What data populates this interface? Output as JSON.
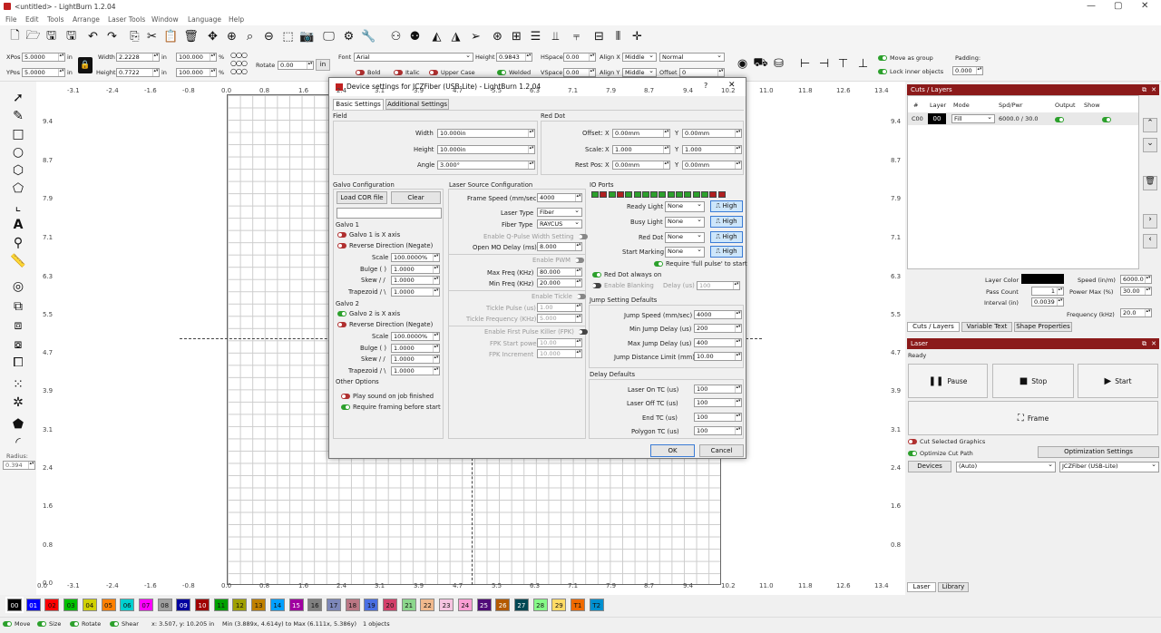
{
  "titlebar": {
    "title": "<untitled> - LightBurn 1.2.04"
  },
  "menu": [
    "File",
    "Edit",
    "Tools",
    "Arrange",
    "Laser Tools",
    "Window",
    "Language",
    "Help"
  ],
  "toolbar2": {
    "xpos_label": "XPos",
    "xpos": "5.0000",
    "ypos_label": "YPos",
    "ypos": "5.0000",
    "unit": "in",
    "width_label": "Width",
    "width": "2.2228",
    "height_label": "Height",
    "height": "0.7722",
    "scale_w": "100.000",
    "scale_h": "100.000",
    "pct": "%",
    "rotate_label": "Rotate",
    "rotate": "0.00",
    "rot_unit": "in",
    "font_label": "Font",
    "font": "Arial",
    "font_height_label": "Height",
    "font_height": "0.9843",
    "hspace_label": "HSpace",
    "hspace": "0.00",
    "vspace_label": "VSpace",
    "vspace": "0.00",
    "alignx_label": "Align X",
    "alignx": "Middle",
    "aligny_label": "Align Y",
    "aligny": "Middle",
    "mode": "Normal",
    "offset_label": "Offset",
    "offset": "0",
    "bold": "Bold",
    "italic": "Italic",
    "upper": "Upper Case",
    "welded": "Welded",
    "move_group": "Move as group",
    "lock_inner": "Lock inner objects",
    "padding_label": "Padding:",
    "padding": "0.000"
  },
  "ruler": {
    "top": [
      "-3.1",
      "-2.4",
      "-1.6",
      "-0.8",
      "0.0",
      "0.8",
      "1.6",
      "2.4",
      "3.1",
      "3.9",
      "4.7",
      "5.5",
      "6.3",
      "7.1",
      "7.9",
      "8.7",
      "9.4",
      "10.2",
      "11.0",
      "11.8",
      "12.6",
      "13.4"
    ],
    "left": [
      "9.4",
      "8.7",
      "7.9",
      "7.1",
      "6.3",
      "5.5",
      "4.7",
      "3.9",
      "3.1",
      "2.4",
      "1.6",
      "0.8",
      "0.0"
    ],
    "right": [
      "9.4",
      "8.7",
      "7.9",
      "7.1",
      "6.3",
      "5.5",
      "4.7",
      "3.9",
      "3.1",
      "2.4",
      "1.6",
      "0.8"
    ],
    "bottom": [
      "0.0",
      "-3.1",
      "-2.4",
      "-1.6",
      "-0.8",
      "0.0",
      "0.8",
      "1.6",
      "2.4",
      "3.1",
      "3.9",
      "4.7",
      "5.5",
      "6.3",
      "7.1",
      "7.9",
      "8.7",
      "9.4",
      "10.2",
      "11.0",
      "11.8",
      "12.6",
      "13.4"
    ]
  },
  "left_tools": {
    "radius_label": "Radius:",
    "radius": "0.394"
  },
  "cuts": {
    "title": "Cuts / Layers",
    "cols": [
      "#",
      "Layer",
      "Mode",
      "Spd/Pwr",
      "Output",
      "Show"
    ],
    "row": {
      "num": "C00",
      "layer": "00",
      "mode": "Fill",
      "spdpwr": "6000.0 / 30.0"
    },
    "layer_color_label": "Layer Color",
    "speed_label": "Speed (in/m)",
    "speed": "6000.0",
    "pass_label": "Pass Count",
    "pass": "1",
    "power_label": "Power Max (%)",
    "power": "30.00",
    "interval_label": "Interval (in)",
    "interval": "0.0039",
    "freq_label": "Frequency (kHz)",
    "freq": "20.0",
    "tabs": [
      "Cuts / Layers",
      "Variable Text",
      "Shape Properties"
    ]
  },
  "laser": {
    "title": "Laser",
    "status": "Ready",
    "pause": "Pause",
    "stop": "Stop",
    "start": "Start",
    "frame": "Frame",
    "cut_selected": "Cut Selected Graphics",
    "optimize": "Optimize Cut Path",
    "opt_settings": "Optimization Settings",
    "devices": "Devices",
    "auto": "(Auto)",
    "device": "JCZFiber (USB-Lite)",
    "tabs": [
      "Laser",
      "Library"
    ]
  },
  "palette": [
    "00",
    "01",
    "02",
    "03",
    "04",
    "05",
    "06",
    "07",
    "08",
    "09",
    "10",
    "11",
    "12",
    "13",
    "14",
    "15",
    "16",
    "17",
    "18",
    "19",
    "20",
    "21",
    "22",
    "23",
    "24",
    "25",
    "26",
    "27",
    "28",
    "29",
    "T1",
    "T2"
  ],
  "status": {
    "move": "Move",
    "size": "Size",
    "rotate": "Rotate",
    "shear": "Shear",
    "coords": "x: 3.507, y: 10.205 in",
    "minmax": "Min (3.889x, 4.614y) to Max (6.111x, 5.386y)",
    "objects": "1 objects"
  },
  "dialog": {
    "title": "Device settings for JCZFiber (USB-Lite) - LightBurn 1.2.04",
    "help": "?",
    "close": "✕",
    "tabs": [
      "Basic Settings",
      "Additional Settings"
    ],
    "field": {
      "title": "Field",
      "width_label": "Width",
      "width": "10.000in",
      "height_label": "Height",
      "height": "10.000in",
      "angle_label": "Angle",
      "angle": "3.000°"
    },
    "reddot": {
      "title": "Red Dot",
      "offset_label": "Offset:",
      "scale_label": "Scale:",
      "rest_label": "Rest Pos:",
      "x": "X",
      "y": "Y",
      "off_x": "0.00mm",
      "off_y": "0.00mm",
      "sc_x": "1.000",
      "sc_y": "1.000",
      "rp_x": "0.00mm",
      "rp_y": "0.00mm"
    },
    "galvo": {
      "title": "Galvo Configuration",
      "load": "Load COR file",
      "clear": "Clear",
      "g1": "Galvo 1",
      "g1x": "Galvo 1 is X axis",
      "rev": "Reverse Direction (Negate)",
      "scale_label": "Scale",
      "bulge_label": "Bulge ( )",
      "skew_label": "Skew / /",
      "trap_label": "Trapezoid / \\",
      "g1_scale": "100.0000%",
      "g1_bulge": "1.0000",
      "g1_skew": "1.0000",
      "g1_trap": "1.0000",
      "g2": "Galvo 2",
      "g2x": "Galvo 2 is X axis",
      "g2_scale": "100.0000%",
      "g2_bulge": "1.0000",
      "g2_skew": "1.0000",
      "g2_trap": "1.0000",
      "other": "Other Options",
      "sound": "Play sound on job finished",
      "framing": "Require framing before start"
    },
    "source": {
      "title": "Laser Source Configuration",
      "frame_speed_label": "Frame Speed (mm/sec)",
      "frame_speed": "4000",
      "type_label": "Laser Type",
      "type": "Fiber",
      "fiber_label": "Fiber Type",
      "fiber": "RAYCUS",
      "qpulse": "Enable Q-Pulse Width Setting",
      "openmo_label": "Open MO Delay (ms)",
      "openmo": "8.000",
      "pwm": "Enable PWM",
      "maxf_label": "Max Freq (KHz)",
      "maxf": "80.000",
      "minf_label": "Min Freq (KHz)",
      "minf": "20.000",
      "tickle": "Enable Tickle",
      "tpulse_label": "Tickle Pulse (us)",
      "tpulse": "1.00",
      "tfreq_label": "Tickle Frequency (KHz)",
      "tfreq": "5.000",
      "fpk": "Enable First Pulse Killer (FPK)",
      "fpks_label": "FPK Start power",
      "fpks": "10.00",
      "fpki_label": "FPK Increment",
      "fpki": "10.000"
    },
    "io": {
      "title": "IO Ports",
      "ready_label": "Ready Light",
      "busy_label": "Busy Light",
      "red_label": "Red Dot",
      "start_label": "Start Marking",
      "none": "None",
      "high": "High",
      "full": "Require 'full pulse' to start",
      "always": "Red Dot always on",
      "blank": "Enable Blanking",
      "delay_label": "Delay (us)",
      "delay": "100"
    },
    "jump": {
      "title": "Jump Setting Defaults",
      "speed_label": "Jump Speed (mm/sec)",
      "speed": "4000",
      "min_label": "Min Jump Delay (us)",
      "min": "200",
      "max_label": "Max Jump Delay (us)",
      "max": "400",
      "dist_label": "Jump Distance Limit (mm)",
      "dist": "10.00"
    },
    "delay": {
      "title": "Delay Defaults",
      "on_label": "Laser On TC (us)",
      "on": "100",
      "off_label": "Laser Off TC (us)",
      "off": "100",
      "end_label": "End TC (us)",
      "end": "100",
      "poly_label": "Polygon TC (us)",
      "poly": "100"
    },
    "ok": "OK",
    "cancel": "Cancel"
  },
  "colors": {
    "accent": "#8b1a1a",
    "toggle_on": "#2ca02c",
    "toggle_off": "#b03030"
  }
}
